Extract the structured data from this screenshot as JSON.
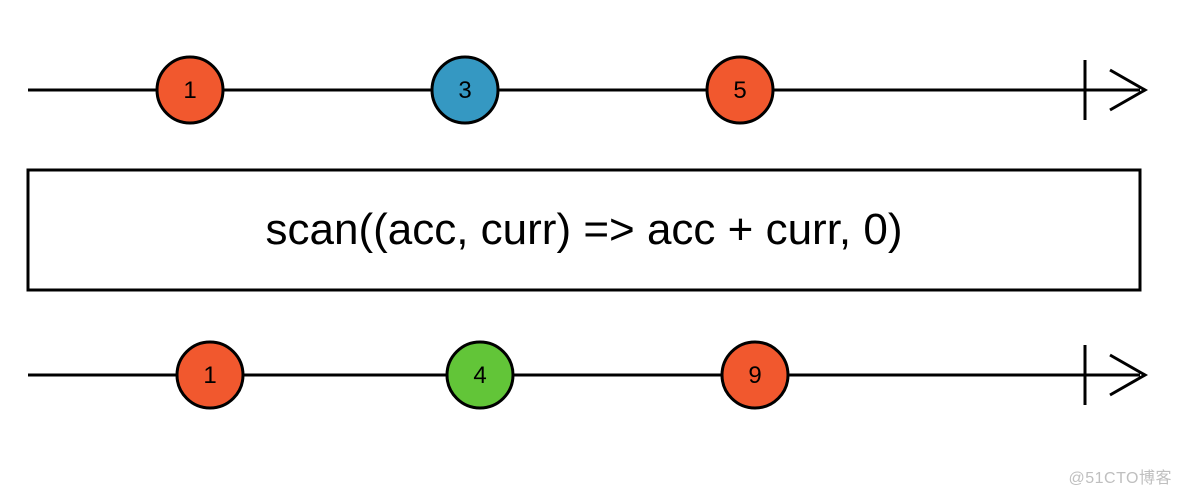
{
  "diagram": {
    "operator_label": "scan((acc, curr) => acc + curr, 0)",
    "input_stream": {
      "marbles": [
        {
          "value": "1",
          "color": "#f1582e"
        },
        {
          "value": "3",
          "color": "#3598c2"
        },
        {
          "value": "5",
          "color": "#f1582e"
        }
      ]
    },
    "output_stream": {
      "marbles": [
        {
          "value": "1",
          "color": "#f1582e"
        },
        {
          "value": "4",
          "color": "#62c538"
        },
        {
          "value": "9",
          "color": "#f1582e"
        }
      ]
    },
    "watermark": "@51CTO博客"
  }
}
